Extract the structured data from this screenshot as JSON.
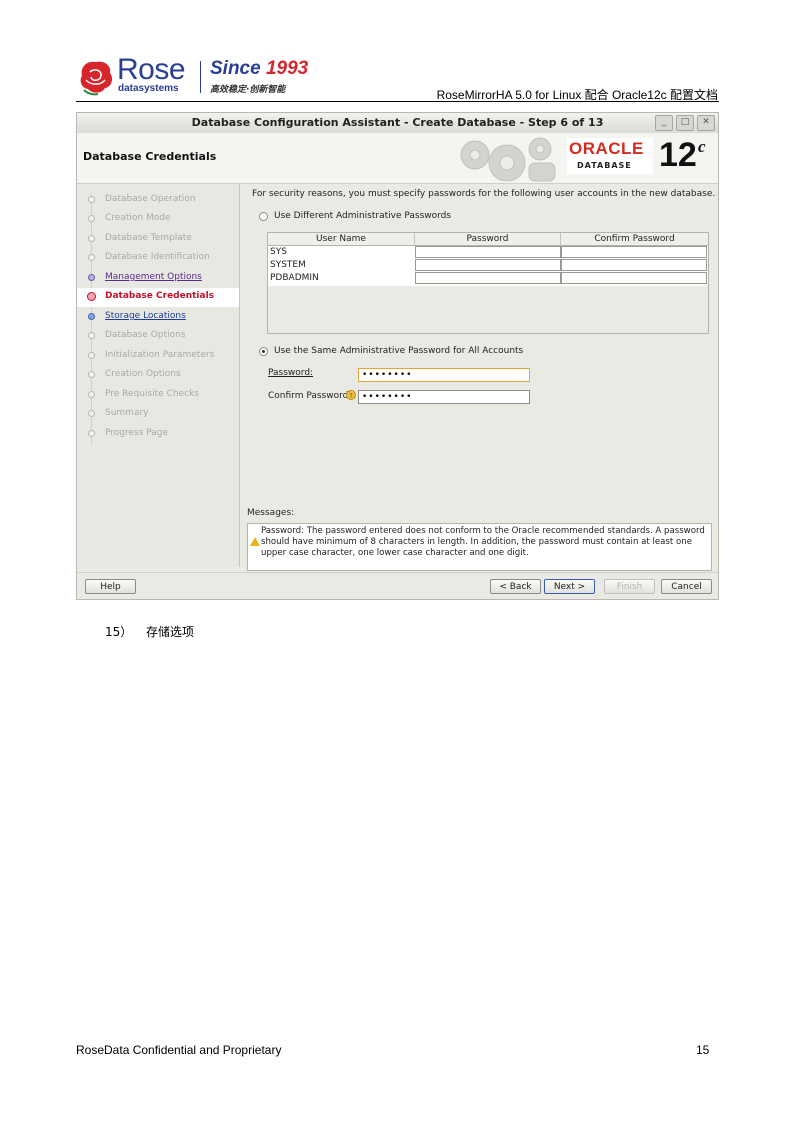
{
  "header": {
    "rose_brand": "Rose",
    "rose_sub": "datasystems",
    "since_part1": "Since",
    "since_part2": "1993",
    "slogan": "高效稳定·创新智能",
    "doc_title": "RoseMirrorHA 5.0 for Linux  配合 Oracle12c 配置文档"
  },
  "dialog": {
    "title": "Database Configuration Assistant - Create Database - Step 6 of 13",
    "window_buttons": [
      "_",
      "□",
      "✕"
    ],
    "banner_title": "Database Credentials",
    "oracle": {
      "brand": "ORACLE",
      "sub": "DATABASE",
      "version": "12",
      "version_sup": "c"
    },
    "nav": [
      {
        "label": "Database Operation",
        "state": "disabled"
      },
      {
        "label": "Creation Mode",
        "state": "disabled"
      },
      {
        "label": "Database Template",
        "state": "disabled"
      },
      {
        "label": "Database Identification",
        "state": "disabled"
      },
      {
        "label": "Management Options",
        "state": "link"
      },
      {
        "label": "Database Credentials",
        "state": "current"
      },
      {
        "label": "Storage Locations",
        "state": "next"
      },
      {
        "label": "Database Options",
        "state": "disabled"
      },
      {
        "label": "Initialization Parameters",
        "state": "disabled"
      },
      {
        "label": "Creation Options",
        "state": "disabled"
      },
      {
        "label": "Pre Requisite Checks",
        "state": "disabled"
      },
      {
        "label": "Summary",
        "state": "disabled"
      },
      {
        "label": "Progress Page",
        "state": "disabled"
      }
    ],
    "intro": "For security reasons, you must specify passwords for the following user accounts in the new database.",
    "option_different": "Use Different Administrative Passwords",
    "table": {
      "columns": [
        "User Name",
        "Password",
        "Confirm Password"
      ],
      "rows": [
        "SYS",
        "SYSTEM",
        "PDBADMIN"
      ]
    },
    "option_same": "Use the Same Administrative Password for All Accounts",
    "password_label": "Password:",
    "password_value": "••••••••",
    "confirm_label": "Confirm Password:",
    "confirm_value": "••••••••",
    "messages_label": "Messages:",
    "message_text": "Password: The password entered does not conform to the Oracle recommended standards. A password should have minimum of 8 characters in length. In addition, the password must contain at least one upper case character, one lower case character and one digit.",
    "buttons": {
      "help": "Help",
      "back": "< Back",
      "next": "Next >",
      "finish": "Finish",
      "cancel": "Cancel"
    }
  },
  "step": {
    "number": "15）",
    "text": "存储选项"
  },
  "footer": {
    "left": "RoseData Confidential and Proprietary",
    "page": "15"
  }
}
